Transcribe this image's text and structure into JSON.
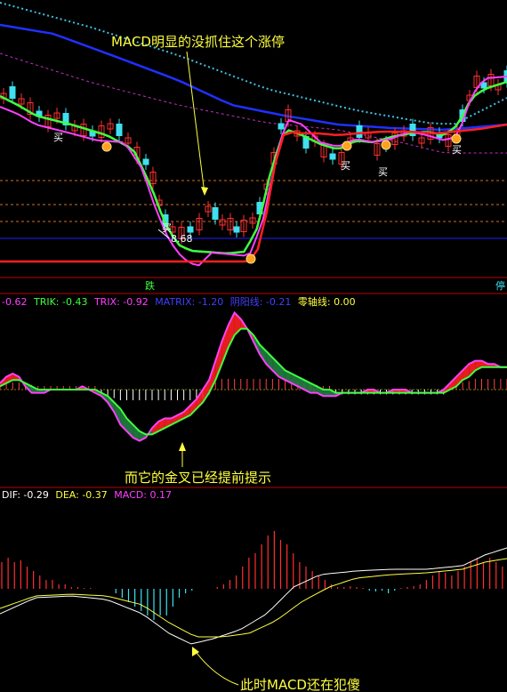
{
  "panel1": {
    "annotation": "MACD明显的没抓住这个涨停",
    "buy_marks": [
      "买",
      "买",
      "买",
      "买",
      "买",
      "买"
    ],
    "price_label": "8.68",
    "axis_labels": [
      "跌",
      "停"
    ]
  },
  "panel2": {
    "indicators": [
      {
        "text": "-0.62",
        "color": "#ff40ff"
      },
      {
        "text": "TRIK: -0.43",
        "color": "#40ff40"
      },
      {
        "text": "TRIX: -0.92",
        "color": "#ff40ff"
      },
      {
        "text": "MATRIX: -1.20",
        "color": "#4040ff"
      },
      {
        "text": "阴阳线: -0.21",
        "color": "#4040ff"
      },
      {
        "text": "零轴线: 0.00",
        "color": "#ffff40"
      }
    ],
    "annotation": "而它的金叉已经提前提示"
  },
  "panel3": {
    "indicators": [
      {
        "text": "DIF: -0.29",
        "color": "#ffffff"
      },
      {
        "text": "DEA: -0.37",
        "color": "#ffff40"
      },
      {
        "text": "MACD: 0.17",
        "color": "#ff40ff"
      }
    ],
    "annotation": "此时MACD还在犯傻"
  },
  "colors": {
    "up": "#ff3030",
    "down": "#40e0f0",
    "ma_green": "#40ff40",
    "ma_magenta": "#ff40ff",
    "ma_red": "#ff2020",
    "ma_blue": "#2030ff",
    "dif": "#ffffff",
    "dea": "#ffff40",
    "divider": "#c00000"
  },
  "chart_data": [
    {
      "type": "line",
      "name": "candlestick price panel with moving averages",
      "x": [
        0,
        1,
        2,
        3,
        4,
        5,
        6,
        7,
        8,
        9,
        10,
        11,
        12,
        13,
        14,
        15,
        16,
        17,
        18,
        19,
        20,
        21,
        22,
        23,
        24,
        25,
        26,
        27,
        28,
        29,
        30,
        31,
        32,
        33,
        34,
        35,
        36,
        37,
        38,
        39,
        40,
        41,
        42,
        43,
        44,
        45,
        46,
        47,
        48,
        49,
        50,
        51,
        52,
        53,
        54,
        55,
        56,
        57,
        58,
        59,
        60,
        61,
        62,
        63,
        64,
        65,
        66,
        67,
        68,
        69,
        70,
        71,
        72,
        73,
        74,
        75,
        76,
        77,
        78,
        79,
        80
      ],
      "series": [
        {
          "values": [
            103,
            105,
            104,
            101,
            99,
            97,
            96,
            95,
            94,
            93,
            92,
            91,
            90,
            89,
            88,
            87,
            87,
            85,
            80,
            72,
            66,
            60,
            56,
            53,
            54,
            55,
            56,
            56,
            54,
            55,
            54,
            55,
            57,
            60,
            64,
            70,
            82,
            88,
            91,
            92,
            91,
            89,
            86,
            85,
            84,
            83,
            84,
            85,
            85,
            86,
            85,
            84,
            85,
            86,
            87,
            88,
            88,
            89,
            89,
            90,
            89,
            88,
            89,
            89,
            90,
            90,
            89,
            88,
            87,
            86,
            88,
            90,
            91,
            94,
            97,
            100,
            103,
            105,
            104,
            103,
            104
          ]
        }
      ]
    },
    {
      "type": "line",
      "name": "TRIX oscillator panel",
      "x": [
        0,
        1,
        2,
        3,
        4,
        5,
        6,
        7,
        8,
        9,
        10,
        11,
        12,
        13,
        14,
        15,
        16,
        17,
        18,
        19,
        20,
        21,
        22,
        23,
        24,
        25,
        26,
        27,
        28,
        29,
        30,
        31,
        32,
        33,
        34,
        35,
        36,
        37,
        38,
        39,
        40,
        41,
        42,
        43,
        44,
        45,
        46,
        47,
        48,
        49,
        50,
        51,
        52,
        53,
        54,
        55,
        56,
        57,
        58,
        59,
        60,
        61,
        62,
        63,
        64,
        65,
        66,
        67,
        68,
        69,
        70,
        71,
        72,
        73,
        74,
        75,
        76,
        77,
        78,
        79,
        80
      ],
      "series": [
        {
          "values": [
            0.2,
            0.4,
            0.5,
            0.4,
            0.1,
            -0.1,
            -0.1,
            -0.1,
            0,
            0,
            0,
            0,
            0,
            0.1,
            0,
            -0.1,
            -0.2,
            -0.4,
            -0.7,
            -1.1,
            -1.3,
            -1.5,
            -1.6,
            -1.5,
            -1.2,
            -1,
            -0.9,
            -0.9,
            -0.8,
            -0.7,
            -0.5,
            -0.3,
            0,
            0.3,
            0.9,
            1.5,
            2,
            2.4,
            2.2,
            1.9,
            1.5,
            1.1,
            0.8,
            0.6,
            0.4,
            0.3,
            0.2,
            0.1,
            0,
            -0.1,
            -0.1,
            -0.2,
            -0.2,
            -0.2,
            -0.1,
            -0.1,
            -0.1,
            -0.1,
            0,
            0,
            -0.1,
            -0.1,
            0,
            0,
            0,
            -0.1,
            -0.1,
            -0.1,
            -0.1,
            -0.1,
            0,
            0.2,
            0.4,
            0.6,
            0.8,
            0.9,
            0.9,
            0.8,
            0.8,
            0.7,
            0.7
          ]
        },
        {
          "values": [
            0.1,
            0.2,
            0.3,
            0.3,
            0.2,
            0.1,
            0,
            0,
            0,
            0,
            0,
            0,
            0,
            0,
            0,
            0,
            -0.1,
            -0.2,
            -0.4,
            -0.6,
            -0.9,
            -1.1,
            -1.3,
            -1.4,
            -1.4,
            -1.3,
            -1.2,
            -1.1,
            -1,
            -0.9,
            -0.8,
            -0.6,
            -0.4,
            -0.1,
            0.3,
            0.8,
            1.3,
            1.7,
            1.9,
            1.9,
            1.7,
            1.4,
            1.2,
            1,
            0.8,
            0.6,
            0.5,
            0.4,
            0.3,
            0.2,
            0.1,
            0,
            0,
            -0.1,
            -0.1,
            -0.1,
            -0.1,
            -0.1,
            -0.1,
            -0.1,
            -0.1,
            -0.1,
            -0.1,
            -0.1,
            -0.1,
            -0.1,
            -0.1,
            -0.1,
            -0.1,
            -0.1,
            -0.1,
            0,
            0.1,
            0.3,
            0.4,
            0.6,
            0.7,
            0.7,
            0.7,
            0.7,
            0.7
          ]
        }
      ]
    },
    {
      "type": "bar",
      "name": "MACD histogram panel",
      "x": [
        0,
        1,
        2,
        3,
        4,
        5,
        6,
        7,
        8,
        9,
        10,
        11,
        12,
        13,
        14,
        15,
        16,
        17,
        18,
        19,
        20,
        21,
        22,
        23,
        24,
        25,
        26,
        27,
        28,
        29,
        30,
        31,
        32,
        33,
        34,
        35,
        36,
        37,
        38,
        39,
        40,
        41,
        42,
        43,
        44,
        45,
        46,
        47,
        48,
        49,
        50,
        51,
        52,
        53,
        54,
        55,
        56,
        57,
        58,
        59,
        60,
        61,
        62,
        63,
        64,
        65,
        66,
        67,
        68,
        69,
        70,
        71,
        72,
        73,
        74,
        75,
        76,
        77,
        78,
        79,
        80
      ],
      "series": [
        {
          "values": [
            0.3,
            0.35,
            0.3,
            0.32,
            0.25,
            0.2,
            0.15,
            0.1,
            0.1,
            0.05,
            0.05,
            0.02,
            0.02,
            0.01,
            0.01,
            0,
            0,
            0,
            -0.05,
            -0.1,
            -0.15,
            -0.2,
            -0.25,
            -0.3,
            -0.35,
            -0.3,
            -0.3,
            -0.2,
            -0.1,
            -0.05,
            -0.02,
            0,
            0,
            0,
            0.02,
            0.05,
            0.1,
            0.15,
            0.25,
            0.35,
            0.4,
            0.5,
            0.6,
            0.65,
            0.55,
            0.5,
            0.4,
            0.3,
            0.25,
            0.2,
            0.15,
            0.1,
            0.05,
            0.02,
            0.02,
            0.03,
            0.02,
            0.01,
            -0.02,
            -0.03,
            -0.02,
            -0.05,
            -0.02,
            0.01,
            0.02,
            0.03,
            0.05,
            0.1,
            0.15,
            0.2,
            0.18,
            0.15,
            0.2,
            0.25,
            0.3,
            0.35,
            0.3,
            0.35,
            0.3,
            0.25,
            0.2
          ]
        }
      ]
    }
  ]
}
